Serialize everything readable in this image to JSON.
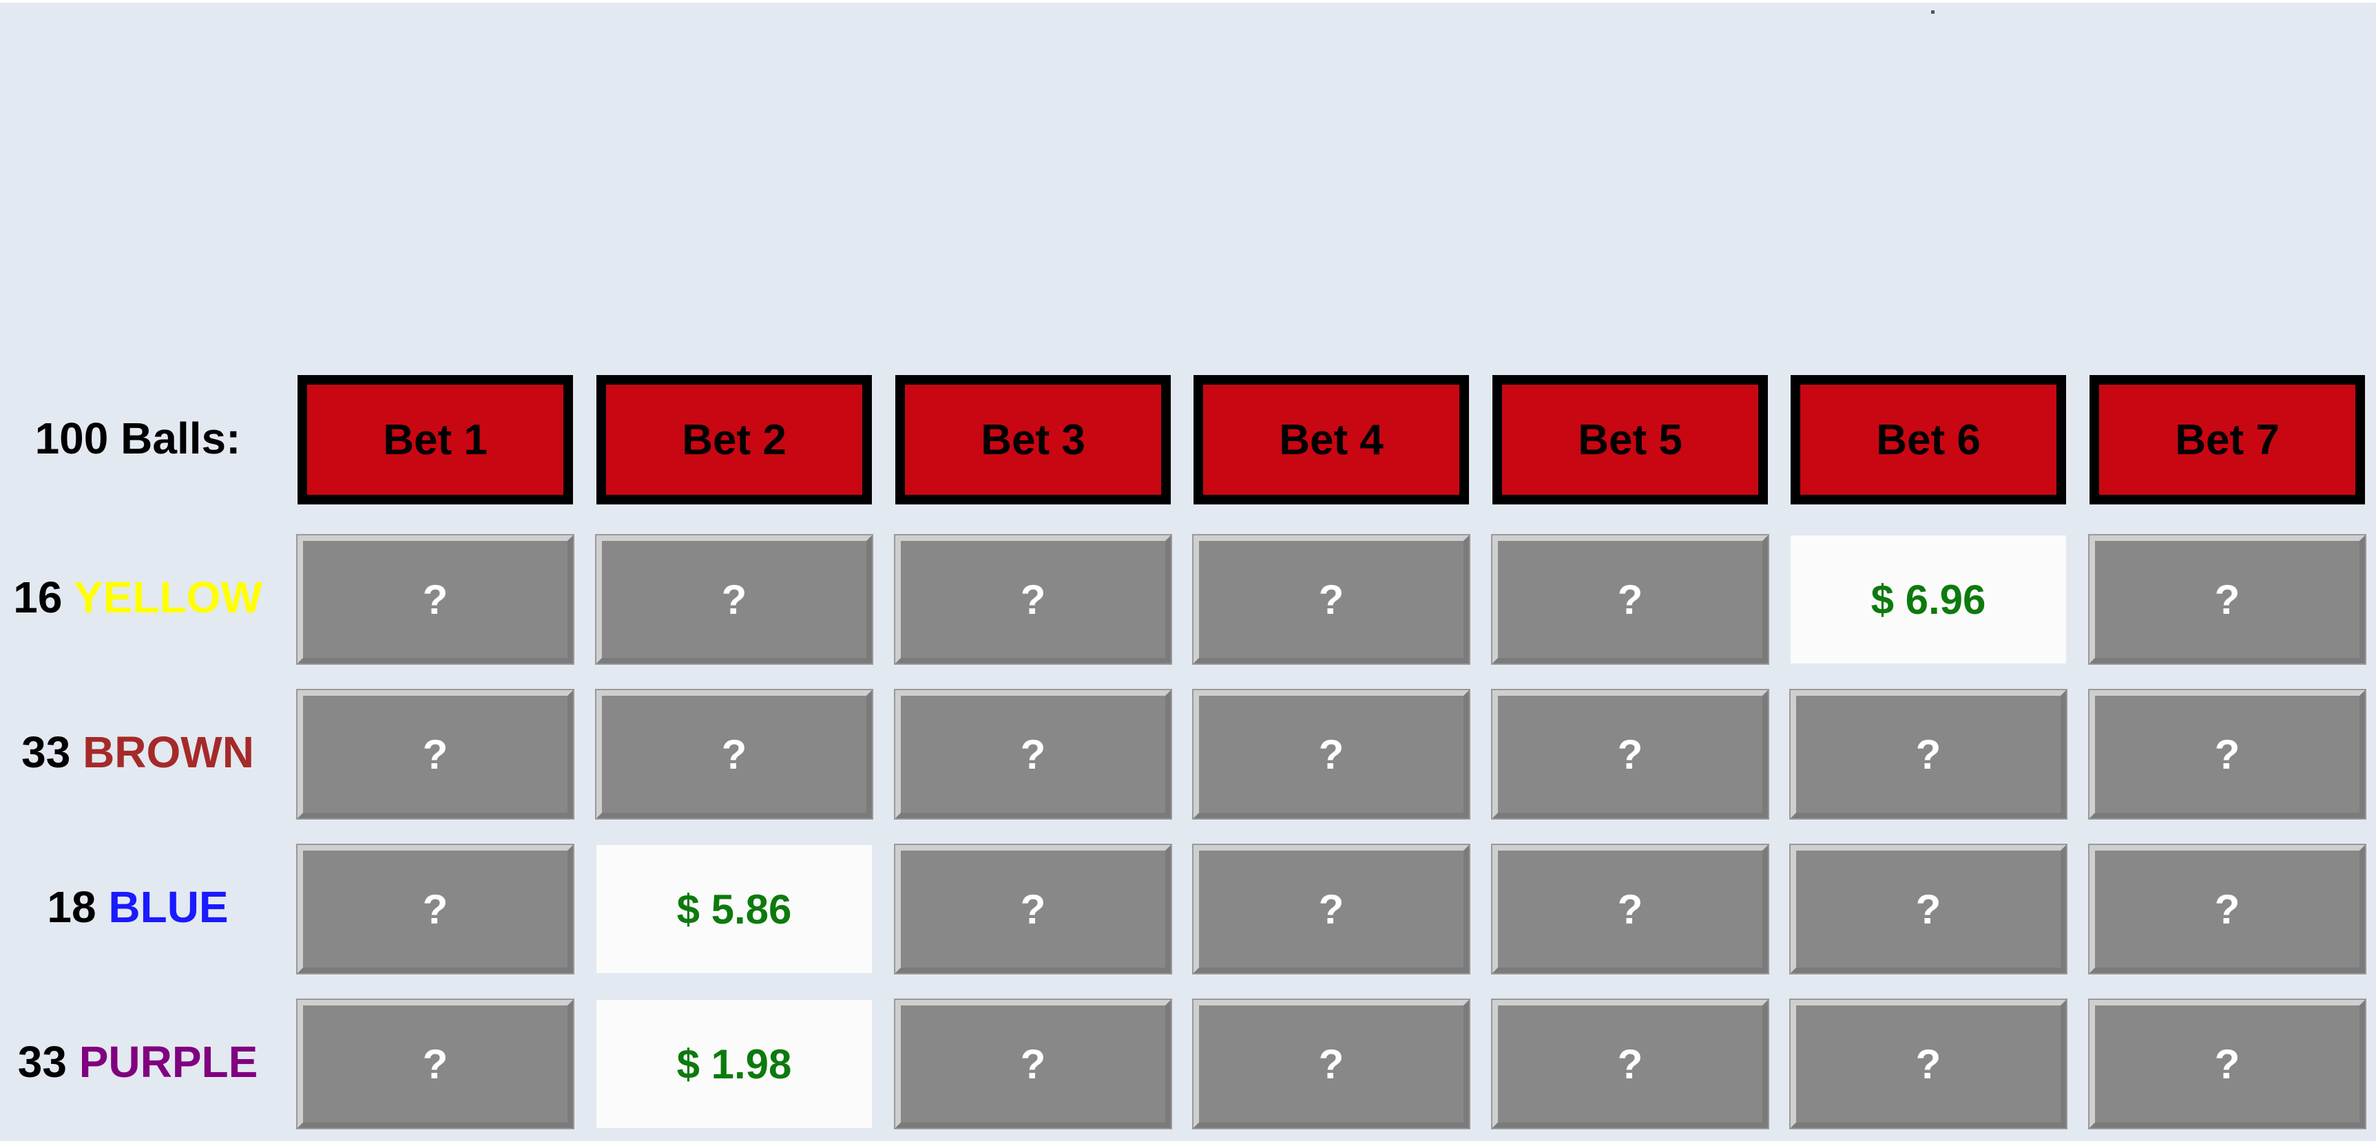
{
  "header": {
    "label": "100 Balls:",
    "bets": [
      "Bet 1",
      "Bet 2",
      "Bet 3",
      "Bet 4",
      "Bet 5",
      "Bet 6",
      "Bet 7"
    ]
  },
  "rows": [
    {
      "count": "16",
      "color_name": "YELLOW",
      "color_hex": "#ffff00",
      "cells": [
        "?",
        "?",
        "?",
        "?",
        "?",
        "$ 6.96",
        "?"
      ],
      "revealed": [
        false,
        false,
        false,
        false,
        false,
        true,
        false
      ]
    },
    {
      "count": "33",
      "color_name": "BROWN",
      "color_hex": "#a52a2a",
      "cells": [
        "?",
        "?",
        "?",
        "?",
        "?",
        "?",
        "?"
      ],
      "revealed": [
        false,
        false,
        false,
        false,
        false,
        false,
        false
      ]
    },
    {
      "count": "18",
      "color_name": "BLUE",
      "color_hex": "#1a1aff",
      "cells": [
        "?",
        "$ 5.86",
        "?",
        "?",
        "?",
        "?",
        "?"
      ],
      "revealed": [
        false,
        true,
        false,
        false,
        false,
        false,
        false
      ]
    },
    {
      "count": "33",
      "color_name": "PURPLE",
      "color_hex": "#800080",
      "cells": [
        "?",
        "$ 1.98",
        "?",
        "?",
        "?",
        "?",
        "?"
      ],
      "revealed": [
        false,
        true,
        false,
        false,
        false,
        false,
        false
      ]
    }
  ],
  "colors": {
    "background": "#e3e9f0",
    "bet_header": "#c80712",
    "hidden_cell": "#888888",
    "revealed_text": "#0d7a0d"
  }
}
